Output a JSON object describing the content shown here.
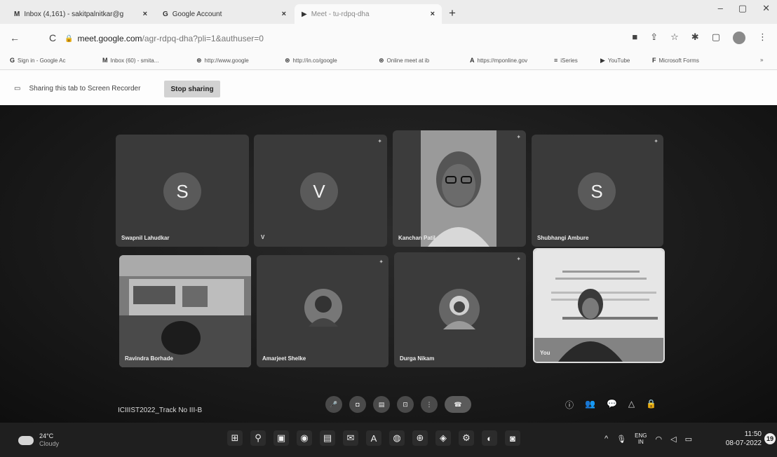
{
  "tabs": [
    {
      "icon": "M",
      "title": "Inbox (4,161) - sakitpalnitkar@g",
      "close": "×"
    },
    {
      "icon": "G",
      "title": "Google Account",
      "close": "×"
    },
    {
      "icon": "▶",
      "title": "Meet - tu-rdpq-dha",
      "close": "×"
    }
  ],
  "new_tab": "+",
  "window_controls": {
    "minimize": "–",
    "maximize": "▢",
    "close": "✕"
  },
  "toolbar": {
    "back": "←",
    "reload": "C",
    "url_host": "meet.google.com",
    "url_path": "/agr-rdpq-dha?pli=1&authuser=0"
  },
  "bookmarks": [
    {
      "icon": "G",
      "label": "Sign in - Google Ac"
    },
    {
      "icon": "M",
      "label": "Inbox (60) - smita..."
    },
    {
      "icon": "⊛",
      "label": "http://www.google"
    },
    {
      "icon": "⊛",
      "label": "http://in.co/google"
    },
    {
      "icon": "⊛",
      "label": "Online meet at ib"
    },
    {
      "icon": "A",
      "label": "https://mponline.gov"
    },
    {
      "icon": "≡",
      "label": "iSeries"
    },
    {
      "icon": "▶",
      "label": "YouTube"
    },
    {
      "icon": "F",
      "label": "Microsoft Forms"
    }
  ],
  "sharing": {
    "text": "Sharing this tab to Screen Recorder",
    "stop_label": "Stop sharing"
  },
  "participants": [
    {
      "name": "Swapnil Lahudkar",
      "initial": "S"
    },
    {
      "name": "",
      "initial": "V"
    },
    {
      "name": "Kanchan Patil",
      "initial": ""
    },
    {
      "name": "Shubhangi Ambure",
      "initial": "S"
    },
    {
      "name": "Ravindra Borhade",
      "initial": ""
    },
    {
      "name": "Amarjeet Shelke",
      "initial": ""
    },
    {
      "name": "Durga Nikam",
      "initial": ""
    },
    {
      "name": "You",
      "initial": ""
    }
  ],
  "v_marker": "V",
  "meeting_name": "ICIIIST2022_Track No III-B",
  "meet_controls": [
    "🎤",
    "◘",
    "▤",
    "⊡",
    "⋮",
    "☎"
  ],
  "meet_right_controls": [
    "ⓘ",
    "👥",
    "💬",
    "△",
    "🔒"
  ],
  "taskbar": {
    "temp": "24°C",
    "weather": "Cloudy",
    "apps": [
      "⊞",
      "⚲",
      "▣",
      "◉",
      "▤",
      "✉",
      "A",
      "◍",
      "⊕",
      "◈",
      "⚙",
      "◐",
      "◙"
    ],
    "lang_top": "ENG",
    "lang_bottom": "IN",
    "time": "11:50",
    "date": "08-07-2022",
    "notifications": "19"
  }
}
